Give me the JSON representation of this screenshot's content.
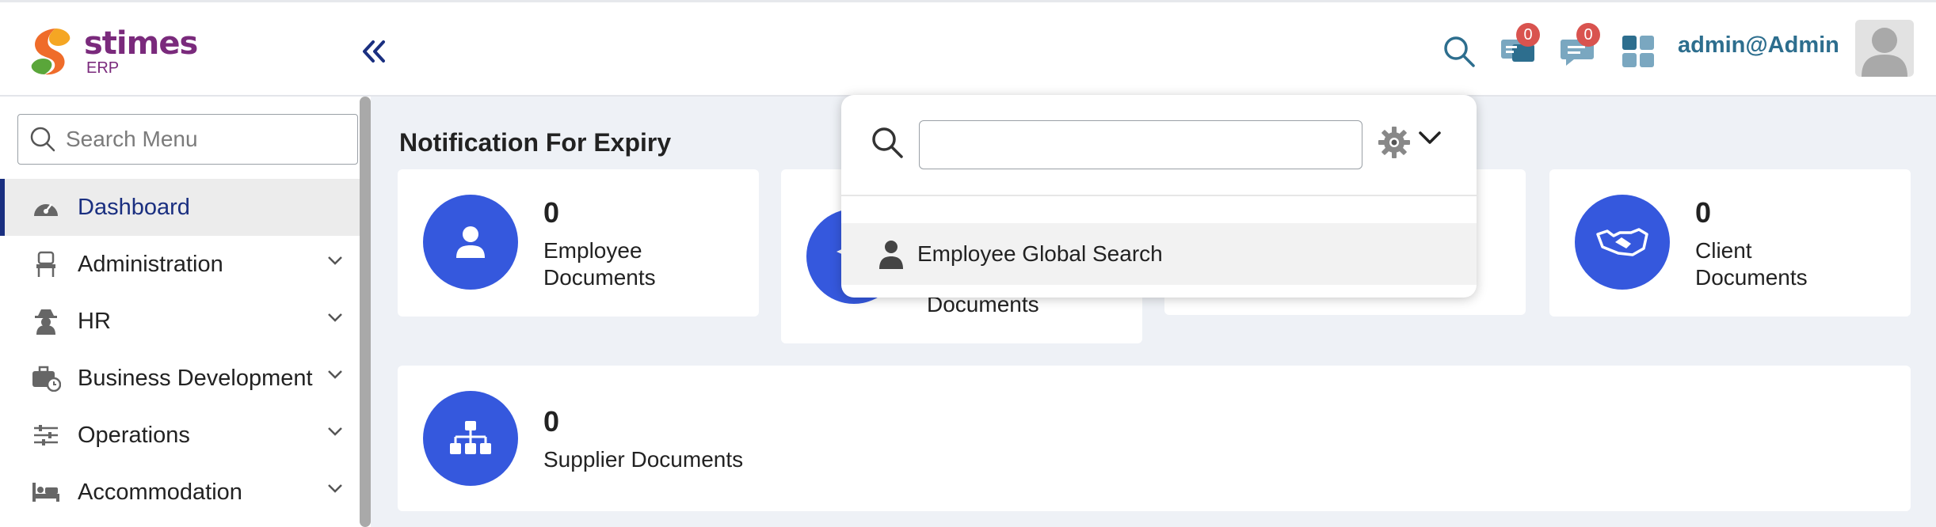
{
  "brand": {
    "name": "stimes",
    "sub": "ERP",
    "colors": {
      "primary": "#7a2a7c",
      "accent": "#3558dd",
      "link": "#2d6e8e",
      "badge": "#d9534f"
    }
  },
  "header": {
    "icons": [
      {
        "name": "search-icon"
      },
      {
        "name": "notification-icon",
        "badge": "0"
      },
      {
        "name": "chat-icon",
        "badge": "0"
      },
      {
        "name": "apps-icon"
      }
    ],
    "user": "admin@Admin"
  },
  "sidebar": {
    "search_placeholder": "Search Menu",
    "items": [
      {
        "label": "Dashboard",
        "icon": "dashboard-icon",
        "active": true
      },
      {
        "label": "Administration",
        "icon": "chair-icon"
      },
      {
        "label": "HR",
        "icon": "spy-icon"
      },
      {
        "label": "Business Development",
        "icon": "briefcase-clock-icon"
      },
      {
        "label": "Operations",
        "icon": "sliders-icon"
      },
      {
        "label": "Accommodation",
        "icon": "bed-icon"
      }
    ]
  },
  "main": {
    "title": "Notification For Expiry",
    "cards": [
      {
        "count": "0",
        "label_line1": "Employee",
        "label_line2": "Documents",
        "icon": "user-icon"
      },
      {
        "count": "",
        "label_line1": "",
        "label_line2": "Documents",
        "icon": "graduation-icon"
      },
      {
        "count": "0",
        "label_line1": "Client",
        "label_line2": "Documents",
        "icon": "handshake-icon"
      },
      {
        "count": "0",
        "label_line1": "Supplier Documents",
        "label_line2": "",
        "icon": "org-chart-icon"
      }
    ]
  },
  "search_dropdown": {
    "input_value": "",
    "results": [
      {
        "label": "Employee Global Search",
        "icon": "person-icon"
      }
    ]
  }
}
